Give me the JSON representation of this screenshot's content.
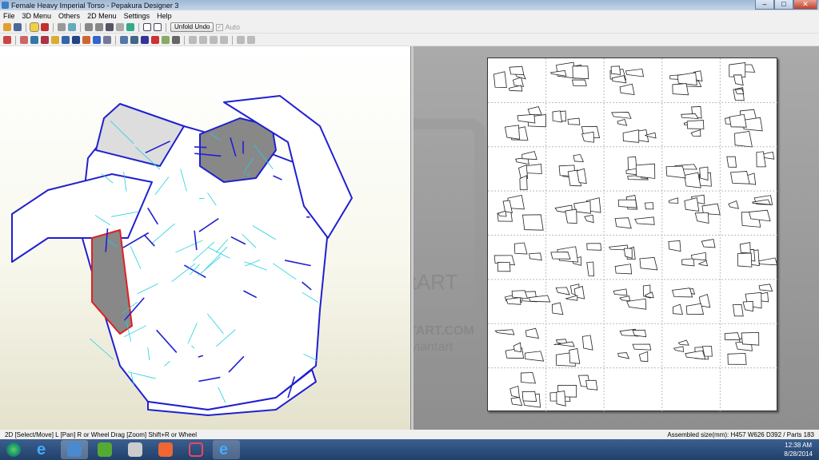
{
  "window": {
    "title": "Female Heavy Imperial Torso - Pepakura Designer 3",
    "minimize": "–",
    "maximize": "□",
    "close": "✕"
  },
  "menu": [
    "File",
    "3D Menu",
    "Others",
    "2D Menu",
    "Settings",
    "Help"
  ],
  "toolbar": {
    "unfold_undo": "Unfold Undo",
    "auto_label": "Auto",
    "auto_checked": true
  },
  "watermark": {
    "brand": "deviantART",
    "url": "WWW.DEVIANTART.COM",
    "credit": "(c) ZombieGrimm.deviantart"
  },
  "layout2d": {
    "columns": 5,
    "rows": 8,
    "filled_cells": 37
  },
  "status": {
    "left": "2D [Select/Move] L [Pan] R or Wheel Drag [Zoom] Shift+R or Wheel",
    "right": "Assembled size(mm): H457 W626 D392 / Parts 183"
  },
  "taskbar": {
    "apps": [
      "start-orb",
      "internet-explorer",
      "pepakura",
      "app-green",
      "app-gray",
      "app-orange",
      "app-pink",
      "internet-explorer-2"
    ],
    "time": "12:38 AM",
    "date": "8/28/2014"
  },
  "colors": {
    "edge_blue": "#2020d0",
    "fold_cyan": "#20d0e0",
    "cut_red": "#e02020"
  }
}
